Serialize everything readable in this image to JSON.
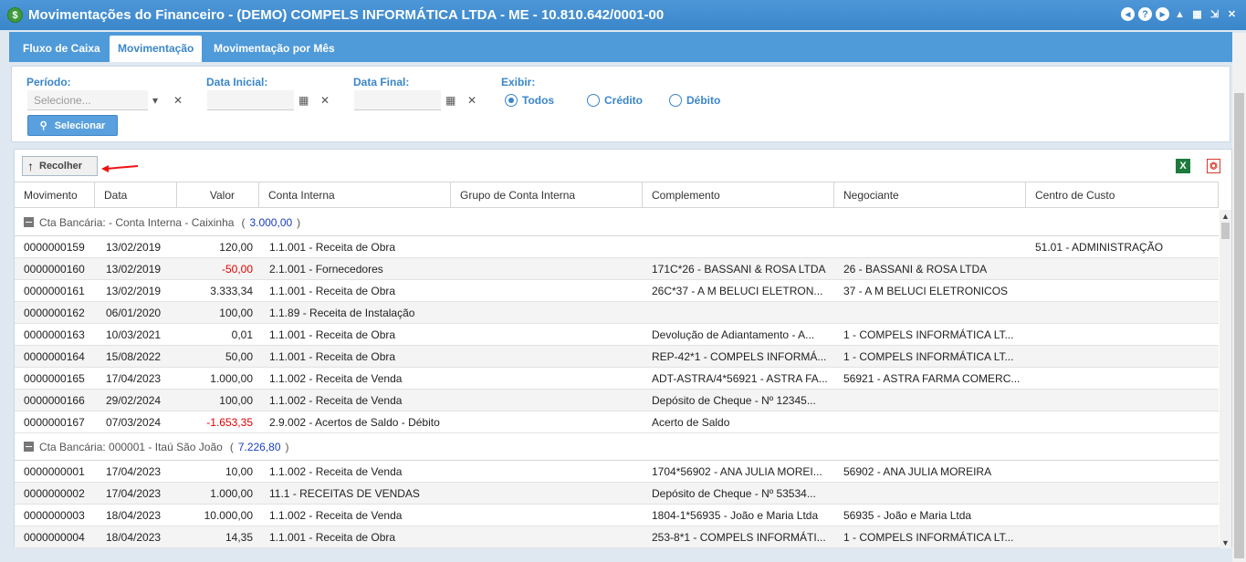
{
  "window": {
    "title": "Movimentações do Financeiro - (DEMO) COMPELS INFORMÁTICA LTDA - ME - 10.810.642/0001-00",
    "app_icon": "$"
  },
  "tabs": [
    {
      "label": "Fluxo de Caixa"
    },
    {
      "label": "Movimentação"
    },
    {
      "label": "Movimentação por Mês"
    }
  ],
  "filters": {
    "periodo_label": "Período:",
    "periodo_placeholder": "Selecione...",
    "data_inicial_label": "Data Inicial:",
    "data_final_label": "Data Final:",
    "exibir_label": "Exibir:",
    "options": [
      "Todos",
      "Crédito",
      "Débito"
    ],
    "selected": "Todos",
    "select_button": "Selecionar"
  },
  "toolbar": {
    "collapse_label": "Recolher"
  },
  "columns": [
    "Movimento",
    "Data",
    "Valor",
    "Conta Interna",
    "Grupo de Conta Interna",
    "Complemento",
    "Negociante",
    "Centro de Custo"
  ],
  "groups": [
    {
      "title": "Cta Bancária: - Conta Interna - Caixinha",
      "total": "3.000,00",
      "rows": [
        {
          "mov": "0000000159",
          "data": "13/02/2019",
          "valor": "120,00",
          "conta": "1.1.001 - Receita de Obra",
          "grupo": "",
          "comp": "",
          "neg": "",
          "cc": "51.01 - ADMINISTRAÇÃO"
        },
        {
          "mov": "0000000160",
          "data": "13/02/2019",
          "valor": "-50,00",
          "conta": "2.1.001 - Fornecedores",
          "grupo": "",
          "comp": "171C*26 - BASSANI & ROSA LTDA",
          "neg": "26 - BASSANI & ROSA LTDA",
          "cc": ""
        },
        {
          "mov": "0000000161",
          "data": "13/02/2019",
          "valor": "3.333,34",
          "conta": "1.1.001 - Receita de Obra",
          "grupo": "",
          "comp": "26C*37 - A M BELUCI ELETRON...",
          "neg": "37 - A M BELUCI ELETRONICOS",
          "cc": ""
        },
        {
          "mov": "0000000162",
          "data": "06/01/2020",
          "valor": "100,00",
          "conta": "1.1.89 - Receita de Instalação",
          "grupo": "",
          "comp": "",
          "neg": "",
          "cc": ""
        },
        {
          "mov": "0000000163",
          "data": "10/03/2021",
          "valor": "0,01",
          "conta": "1.1.001 - Receita de Obra",
          "grupo": "",
          "comp": "Devolução de Adiantamento - A...",
          "neg": "1 - COMPELS INFORMÁTICA LT...",
          "cc": ""
        },
        {
          "mov": "0000000164",
          "data": "15/08/2022",
          "valor": "50,00",
          "conta": "1.1.001 - Receita de Obra",
          "grupo": "",
          "comp": "REP-42*1 - COMPELS INFORMÁ...",
          "neg": "1 - COMPELS INFORMÁTICA LT...",
          "cc": ""
        },
        {
          "mov": "0000000165",
          "data": "17/04/2023",
          "valor": "1.000,00",
          "conta": "1.1.002 - Receita de Venda",
          "grupo": "",
          "comp": "ADT-ASTRA/4*56921 - ASTRA FA...",
          "neg": "56921 - ASTRA FARMA COMERC...",
          "cc": ""
        },
        {
          "mov": "0000000166",
          "data": "29/02/2024",
          "valor": "100,00",
          "conta": "1.1.002 - Receita de Venda",
          "grupo": "",
          "comp": "Depósito de Cheque - Nº 12345...",
          "neg": "",
          "cc": ""
        },
        {
          "mov": "0000000167",
          "data": "07/03/2024",
          "valor": "-1.653,35",
          "conta": "2.9.002 - Acertos de Saldo - Débito",
          "grupo": "",
          "comp": "Acerto de Saldo",
          "neg": "",
          "cc": ""
        }
      ]
    },
    {
      "title": "Cta Bancária: 000001 - Itaú São João",
      "total": "7.226,80",
      "rows": [
        {
          "mov": "0000000001",
          "data": "17/04/2023",
          "valor": "10,00",
          "conta": "1.1.002 - Receita de Venda",
          "grupo": "",
          "comp": "1704*56902 - ANA JULIA MOREI...",
          "neg": "56902 - ANA JULIA MOREIRA",
          "cc": ""
        },
        {
          "mov": "0000000002",
          "data": "17/04/2023",
          "valor": "1.000,00",
          "conta": "11.1 - RECEITAS DE VENDAS",
          "grupo": "",
          "comp": "Depósito de Cheque - Nº 53534...",
          "neg": "",
          "cc": ""
        },
        {
          "mov": "0000000003",
          "data": "18/04/2023",
          "valor": "10.000,00",
          "conta": "1.1.002 - Receita de Venda",
          "grupo": "",
          "comp": "1804-1*56935 - João e Maria Ltda",
          "neg": "56935 - João e Maria Ltda",
          "cc": ""
        },
        {
          "mov": "0000000004",
          "data": "18/04/2023",
          "valor": "14,35",
          "conta": "1.1.001 - Receita de Obra",
          "grupo": "",
          "comp": "253-8*1 - COMPELS INFORMÁTI...",
          "neg": "1 - COMPELS INFORMÁTICA LT...",
          "cc": ""
        }
      ]
    }
  ],
  "colors": {
    "titlebar": "#3a86ca",
    "tabbar": "#4f9ad9",
    "negative": "#e00000",
    "group_total": "#1a3fbd"
  }
}
